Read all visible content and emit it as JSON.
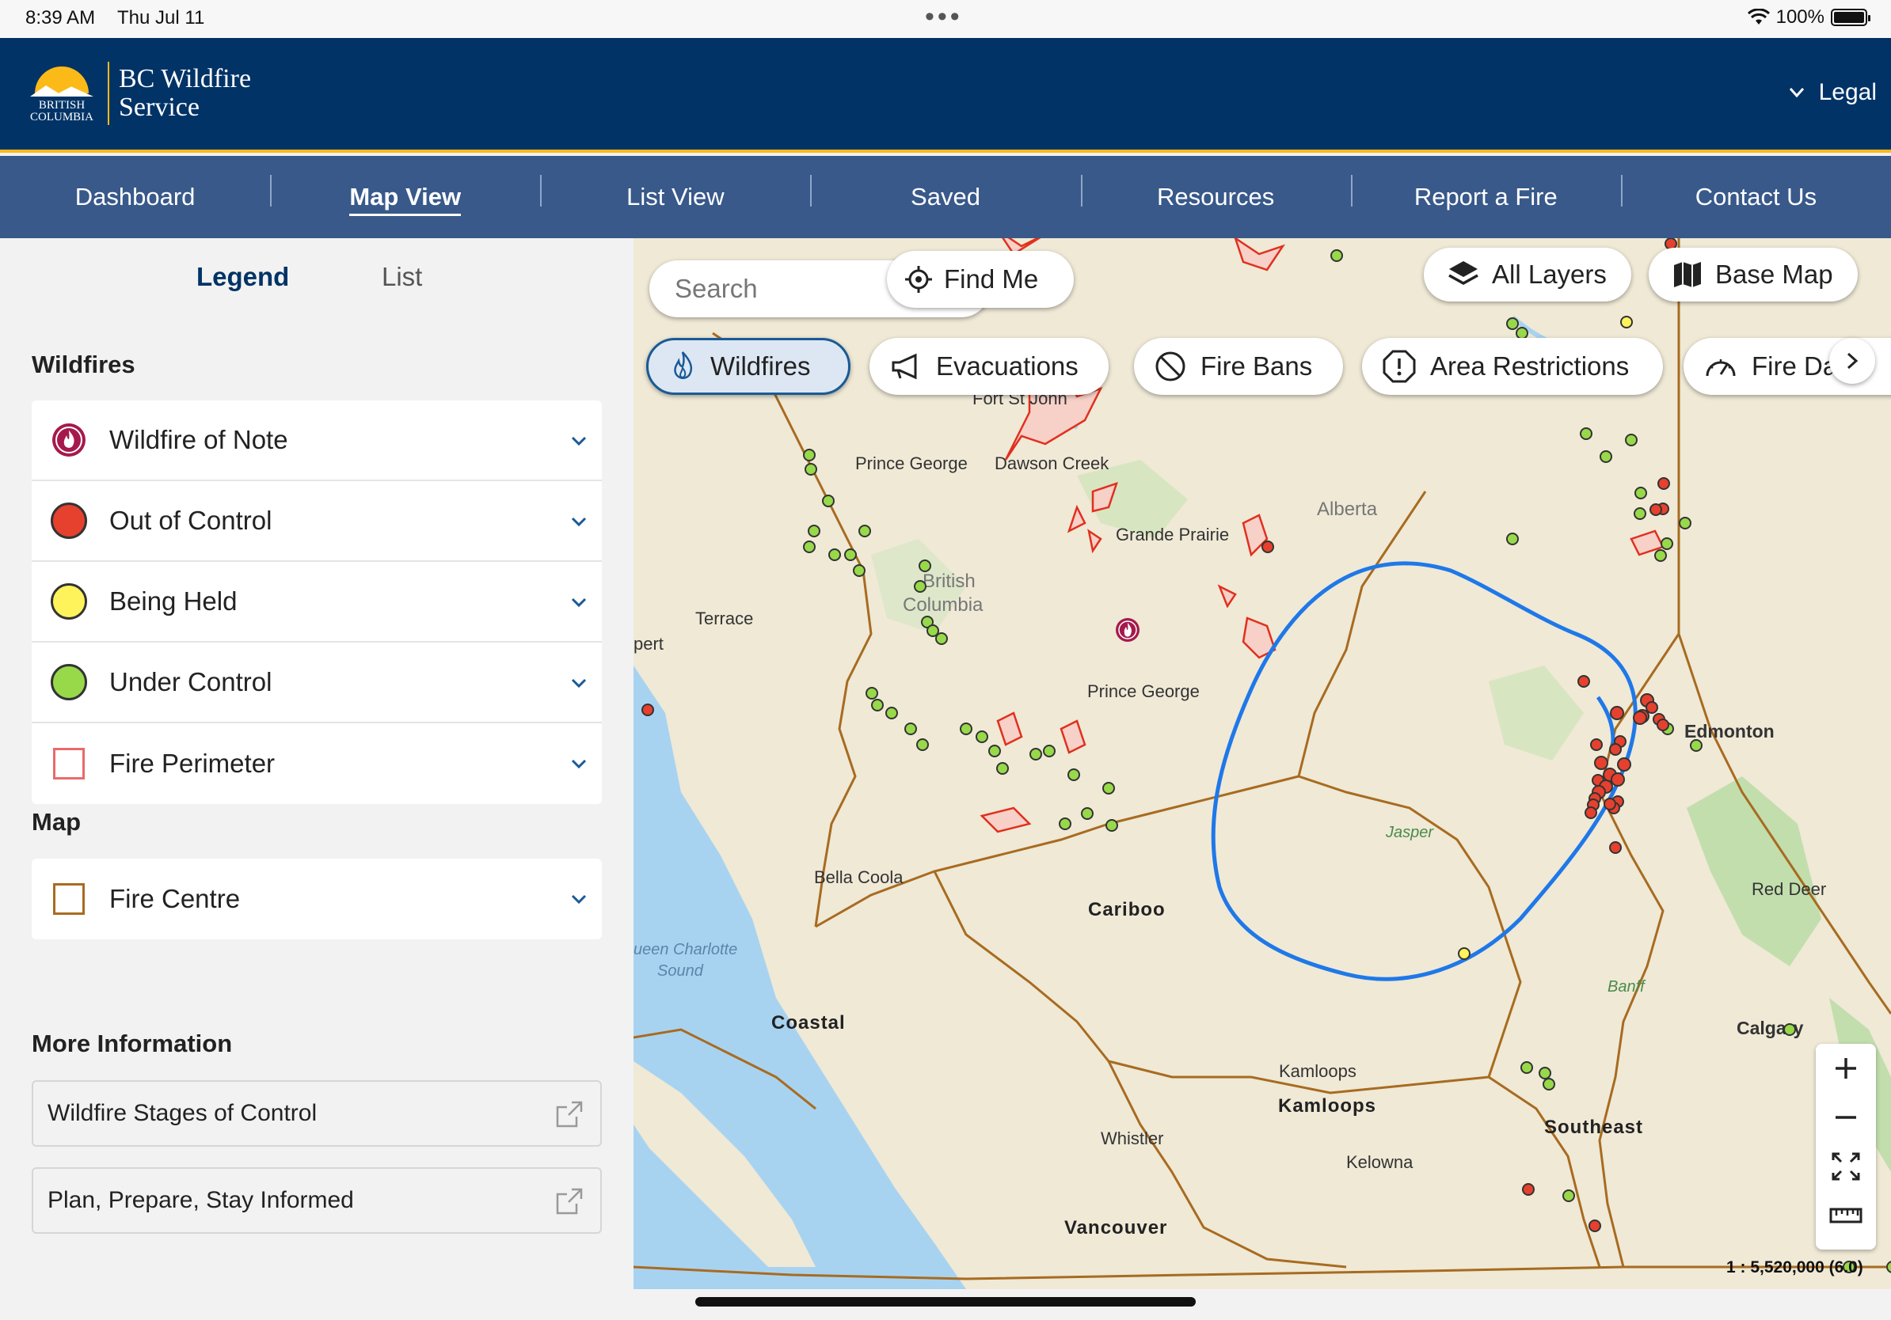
{
  "status_bar": {
    "time": "8:39 AM",
    "date": "Thu Jul 11",
    "battery": "100%"
  },
  "header": {
    "logo_line1": "BC Wildfire",
    "logo_line2": "Service",
    "logo_bc_1": "BRITISH",
    "logo_bc_2": "COLUMBIA",
    "legal": "Legal"
  },
  "nav": {
    "items": [
      "Dashboard",
      "Map View",
      "List View",
      "Saved",
      "Resources",
      "Report a Fire",
      "Contact Us"
    ],
    "active": "Map View"
  },
  "sidebar": {
    "tabs": {
      "legend": "Legend",
      "list": "List"
    },
    "wildfires_title": "Wildfires",
    "wildfire_items": [
      {
        "label": "Wildfire of Note",
        "color": "#a6194c"
      },
      {
        "label": "Out of Control",
        "color": "#e5412e"
      },
      {
        "label": "Being Held",
        "color": "#fff35c"
      },
      {
        "label": "Under Control",
        "color": "#98d94a"
      },
      {
        "label": "Fire Perimeter",
        "color": "#e96a6a"
      }
    ],
    "map_title": "Map",
    "map_items": [
      {
        "label": "Fire Centre",
        "color": "#a86b20"
      }
    ],
    "more_info_title": "More Information",
    "more_info_links": [
      "Wildfire Stages of Control",
      "Plan, Prepare, Stay Informed"
    ]
  },
  "map": {
    "search_placeholder": "Search",
    "find_me": "Find Me",
    "all_layers": "All Layers",
    "base_map": "Base Map",
    "filters": [
      "Wildfires",
      "Evacuations",
      "Fire Bans",
      "Area Restrictions",
      "Fire Da"
    ],
    "scale": "1 : 5,520,000 (6.0)",
    "labels": {
      "prince_george_top": "Prince George",
      "fort_st_john": "Fort St John",
      "dawson_creek": "Dawson Creek",
      "grande_prairie": "Grande Prairie",
      "alberta": "Alberta",
      "british": "British",
      "columbia": "Columbia",
      "terrace": "Terrace",
      "prupert": "pert",
      "prince_george": "Prince George",
      "edmonton": "Edmonton",
      "jasper": "Jasper",
      "bella_coola": "Bella Coola",
      "cariboo": "Cariboo",
      "red_deer": "Red Deer",
      "queen_charlotte_1": "ueen Charlotte",
      "queen_charlotte_2": "Sound",
      "banff": "Banff",
      "coastal": "Coastal",
      "calgary": "Calgary",
      "kamloops_city": "Kamloops",
      "kamloops": "Kamloops",
      "southeast": "Southeast",
      "whistler": "Whistler",
      "kelowna": "Kelowna",
      "vancouver": "Vancouver"
    }
  }
}
